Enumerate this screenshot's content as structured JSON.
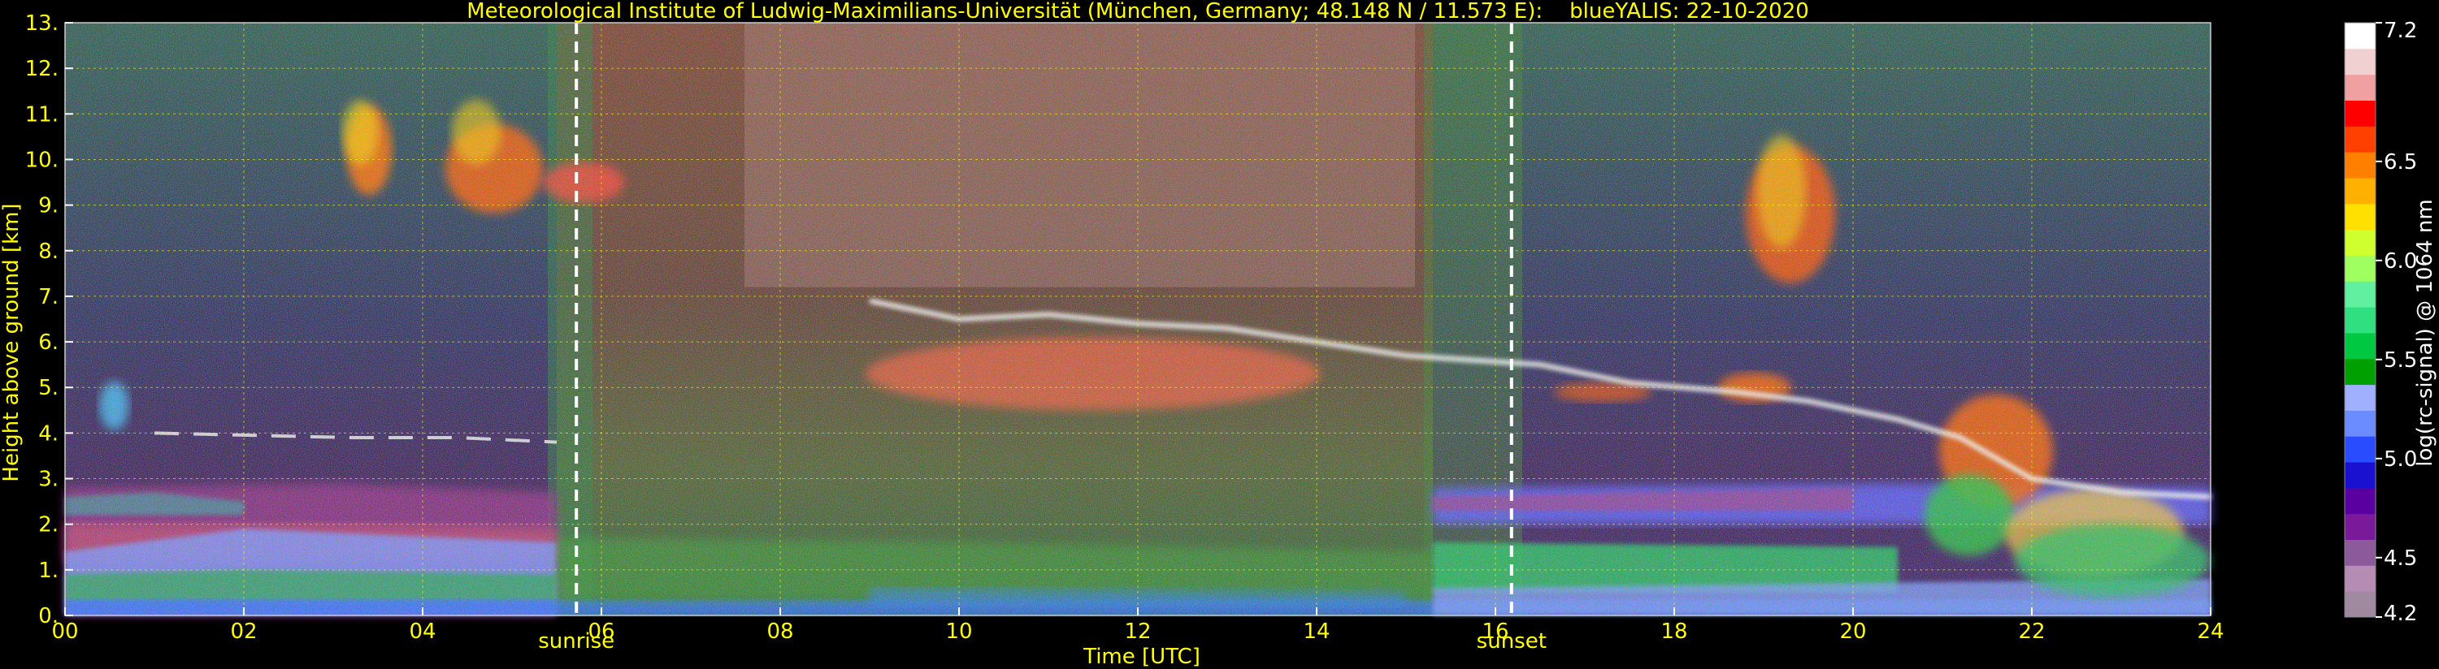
{
  "chart_data": {
    "type": "heatmap",
    "title": "Meteorological Institute of Ludwig-Maximilians-Universität (München, Germany; 48.148 N / 11.573 E):    blueYALIS: 22-10-2020",
    "xlabel": "Time [UTC]",
    "ylabel": "Height above ground [km]",
    "xlim": [
      0,
      24
    ],
    "ylim": [
      0,
      13
    ],
    "x_ticks": [
      "00",
      "02",
      "04",
      "06",
      "08",
      "10",
      "12",
      "14",
      "16",
      "18",
      "20",
      "22",
      "24"
    ],
    "y_ticks": [
      "0.",
      "1.",
      "2.",
      "3.",
      "4.",
      "5.",
      "6.",
      "7.",
      "8.",
      "9.",
      "10.",
      "11.",
      "12.",
      "13."
    ],
    "grid": true,
    "events": [
      {
        "label": "sunrise",
        "time": 5.72
      },
      {
        "label": "sunset",
        "time": 16.18
      }
    ],
    "colorbar": {
      "label": "log(rc-signal) @ 1064 nm",
      "range": [
        4.2,
        7.2
      ],
      "tick_labels": [
        "4.2",
        "4.5",
        "5.0",
        "5.5",
        "6.0",
        "6.5",
        "7.2"
      ],
      "tick_values": [
        4.2,
        4.5,
        5.0,
        5.5,
        6.0,
        6.5,
        7.2
      ],
      "colors": [
        "#a08aa0",
        "#b48cb4",
        "#8c5a9a",
        "#7a1a9a",
        "#5a00a0",
        "#1a10d0",
        "#2a4cff",
        "#6a8cff",
        "#a0b0ff",
        "#00a000",
        "#00c840",
        "#30e080",
        "#60f0a0",
        "#a0ff60",
        "#d0ff30",
        "#ffe000",
        "#ffb000",
        "#ff8000",
        "#ff4000",
        "#ff0000",
        "#f0a0a0",
        "#f0d0d0",
        "#ffffff"
      ]
    }
  }
}
